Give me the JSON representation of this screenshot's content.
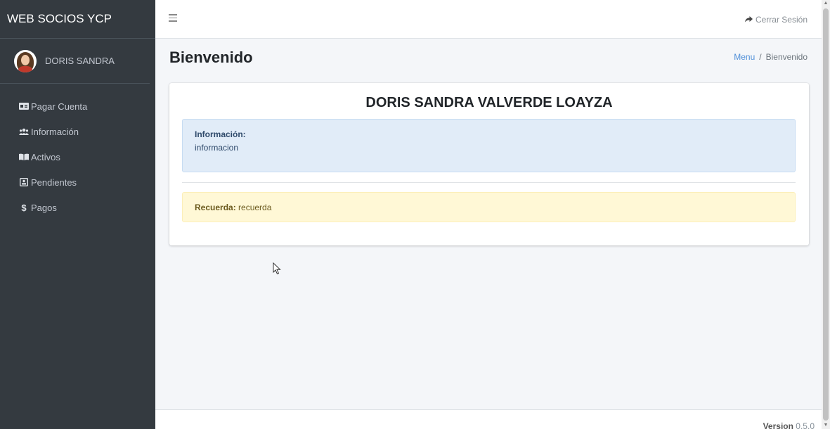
{
  "brand": "WEB SOCIOS YCP",
  "user": {
    "name": "DORIS SANDRA"
  },
  "sidebar": {
    "items": [
      {
        "label": "Pagar Cuenta",
        "icon": "money-bill-icon"
      },
      {
        "label": "Información",
        "icon": "users-icon"
      },
      {
        "label": "Activos",
        "icon": "book-open-icon"
      },
      {
        "label": "Pendientes",
        "icon": "clipboard-icon"
      },
      {
        "label": "Pagos",
        "icon": "dollar-icon"
      }
    ]
  },
  "topbar": {
    "logout_label": "Cerrar Sesión"
  },
  "page": {
    "title": "Bienvenido",
    "breadcrumb": {
      "home": "Menu",
      "separator": "/",
      "current": "Bienvenido"
    }
  },
  "card": {
    "title": "DORIS SANDRA VALVERDE LOAYZA",
    "info_label": "Información:",
    "info_text": "informacion",
    "remember_label": "Recuerda:",
    "remember_text": "recuerda"
  },
  "footer": {
    "version_label": "Version",
    "version_number": "0.5.0"
  },
  "colors": {
    "sidebar": "#343a40",
    "link": "#4f8fd8",
    "info_bg": "#e1ecf8",
    "warning_bg": "#fff8d6"
  }
}
